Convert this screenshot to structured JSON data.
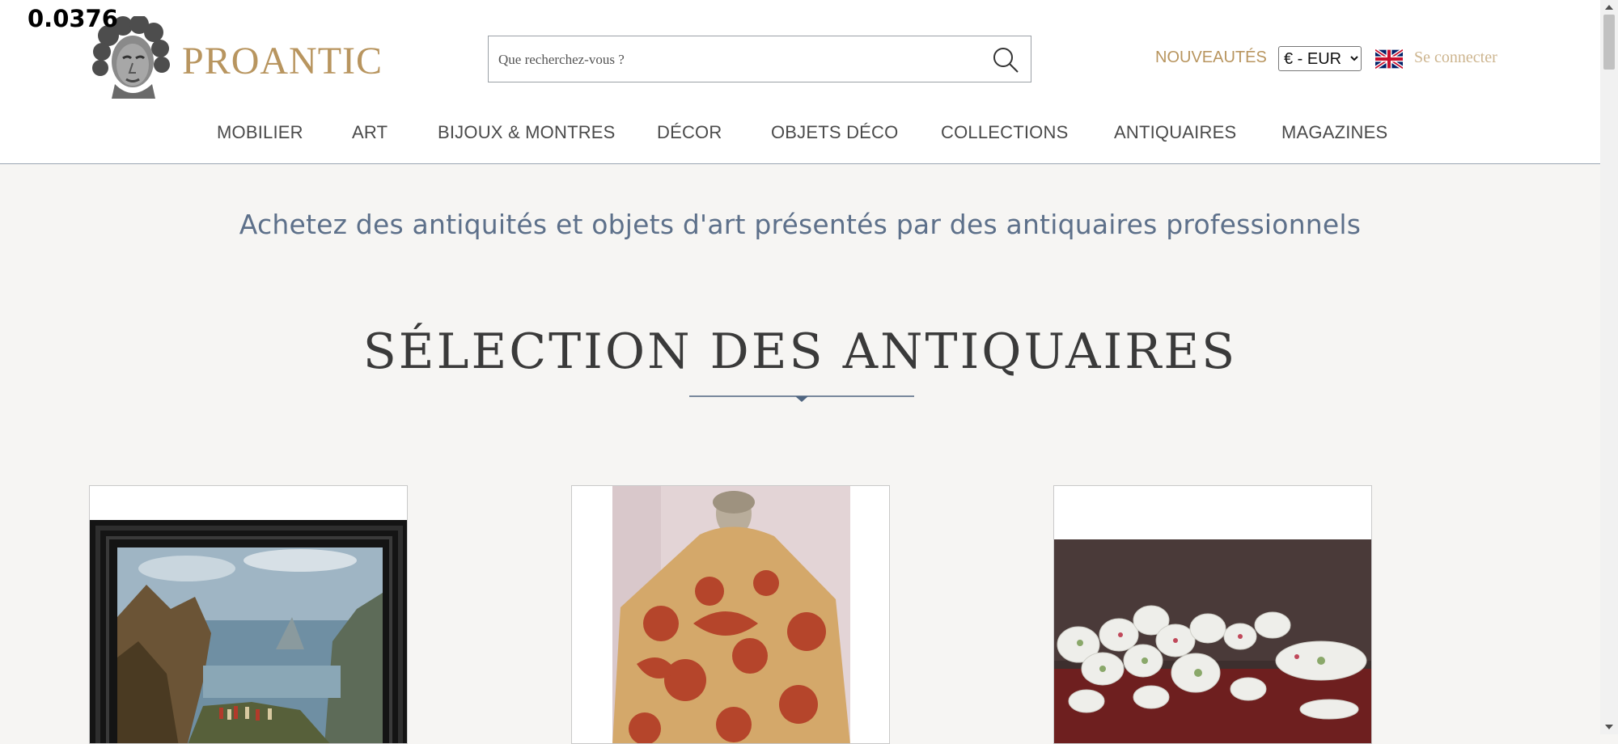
{
  "debug_value": "0.0376",
  "brand": {
    "name": "PROANTIC",
    "accent": "#b8955f"
  },
  "search": {
    "placeholder": "Que recherchez-vous ?",
    "value": "",
    "icon": "search-icon"
  },
  "header": {
    "new_label": "NOUVEAUTÉS",
    "currency": {
      "selected": "€ - EUR"
    },
    "language_icon": "uk-flag-icon",
    "login_label": "Se connecter"
  },
  "nav": {
    "items": [
      {
        "label": "MOBILIER"
      },
      {
        "label": "ART"
      },
      {
        "label": "BIJOUX & MONTRES"
      },
      {
        "label": "DÉCOR"
      },
      {
        "label": "OBJETS DÉCO"
      },
      {
        "label": "COLLECTIONS"
      },
      {
        "label": "ANTIQUAIRES"
      },
      {
        "label": "MAGAZINES"
      }
    ]
  },
  "tagline": "Achetez des antiquités et objets d'art présentés par des antiquaires professionnels",
  "section": {
    "title": "SÉLECTION DES ANTIQUAIRES"
  },
  "products": [
    {
      "image": "framed-landscape-painting"
    },
    {
      "image": "red-damask-fabric-bust"
    },
    {
      "image": "porcelain-dinner-service"
    }
  ],
  "colors": {
    "tagline": "#5d708a",
    "divider": "#4f6580",
    "login": "#cdb58f"
  }
}
